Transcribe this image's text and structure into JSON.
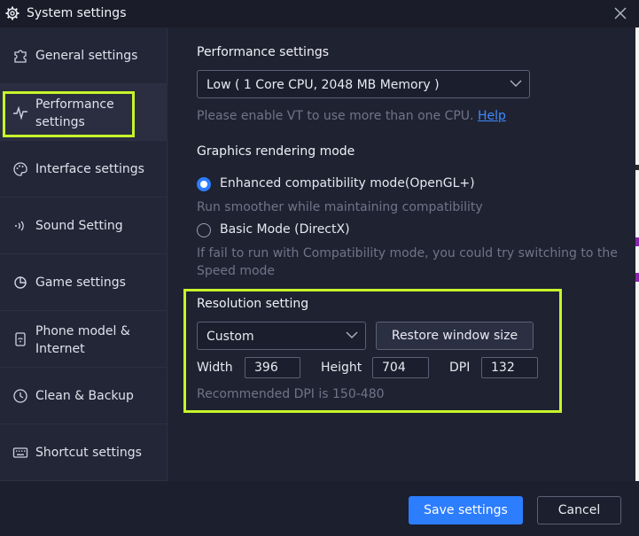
{
  "window": {
    "title": "System settings"
  },
  "sidebar": {
    "items": [
      {
        "label": "General settings",
        "icon": "puzzle-icon"
      },
      {
        "label": "Performance settings",
        "icon": "pulse-icon",
        "active": true
      },
      {
        "label": "Interface settings",
        "icon": "palette-icon"
      },
      {
        "label": "Sound Setting",
        "icon": "sound-icon"
      },
      {
        "label": "Game settings",
        "icon": "game-icon"
      },
      {
        "label": "Phone model & Internet",
        "icon": "phone-wifi-icon"
      },
      {
        "label": "Clean & Backup",
        "icon": "clean-icon"
      },
      {
        "label": "Shortcut settings",
        "icon": "keyboard-icon"
      }
    ]
  },
  "performance": {
    "title": "Performance settings",
    "selected": "Low ( 1 Core CPU, 2048 MB Memory )",
    "hint": "Please enable VT to use more than one CPU.",
    "help_link": "Help"
  },
  "graphics": {
    "title": "Graphics rendering mode",
    "option1": "Enhanced compatibility mode(OpenGL+)",
    "option1_desc": "Run smoother while maintaining compatibility",
    "option2": "Basic Mode (DirectX)",
    "option2_desc": " If fail to run with Compatibility mode, you could try switching to the Speed mode",
    "selected_option": "option1"
  },
  "resolution": {
    "title": "Resolution setting",
    "selected": "Custom",
    "restore_label": "Restore window size",
    "width_label": "Width",
    "width_value": "396",
    "height_label": "Height",
    "height_value": "704",
    "dpi_label": "DPI",
    "dpi_value": "132",
    "hint": "Recommended DPI is 150-480"
  },
  "footer": {
    "save_label": "Save settings",
    "cancel_label": "Cancel"
  },
  "colors": {
    "accent": "#2d7dff",
    "highlight": "#c6f52a",
    "background": "#1f2231"
  }
}
